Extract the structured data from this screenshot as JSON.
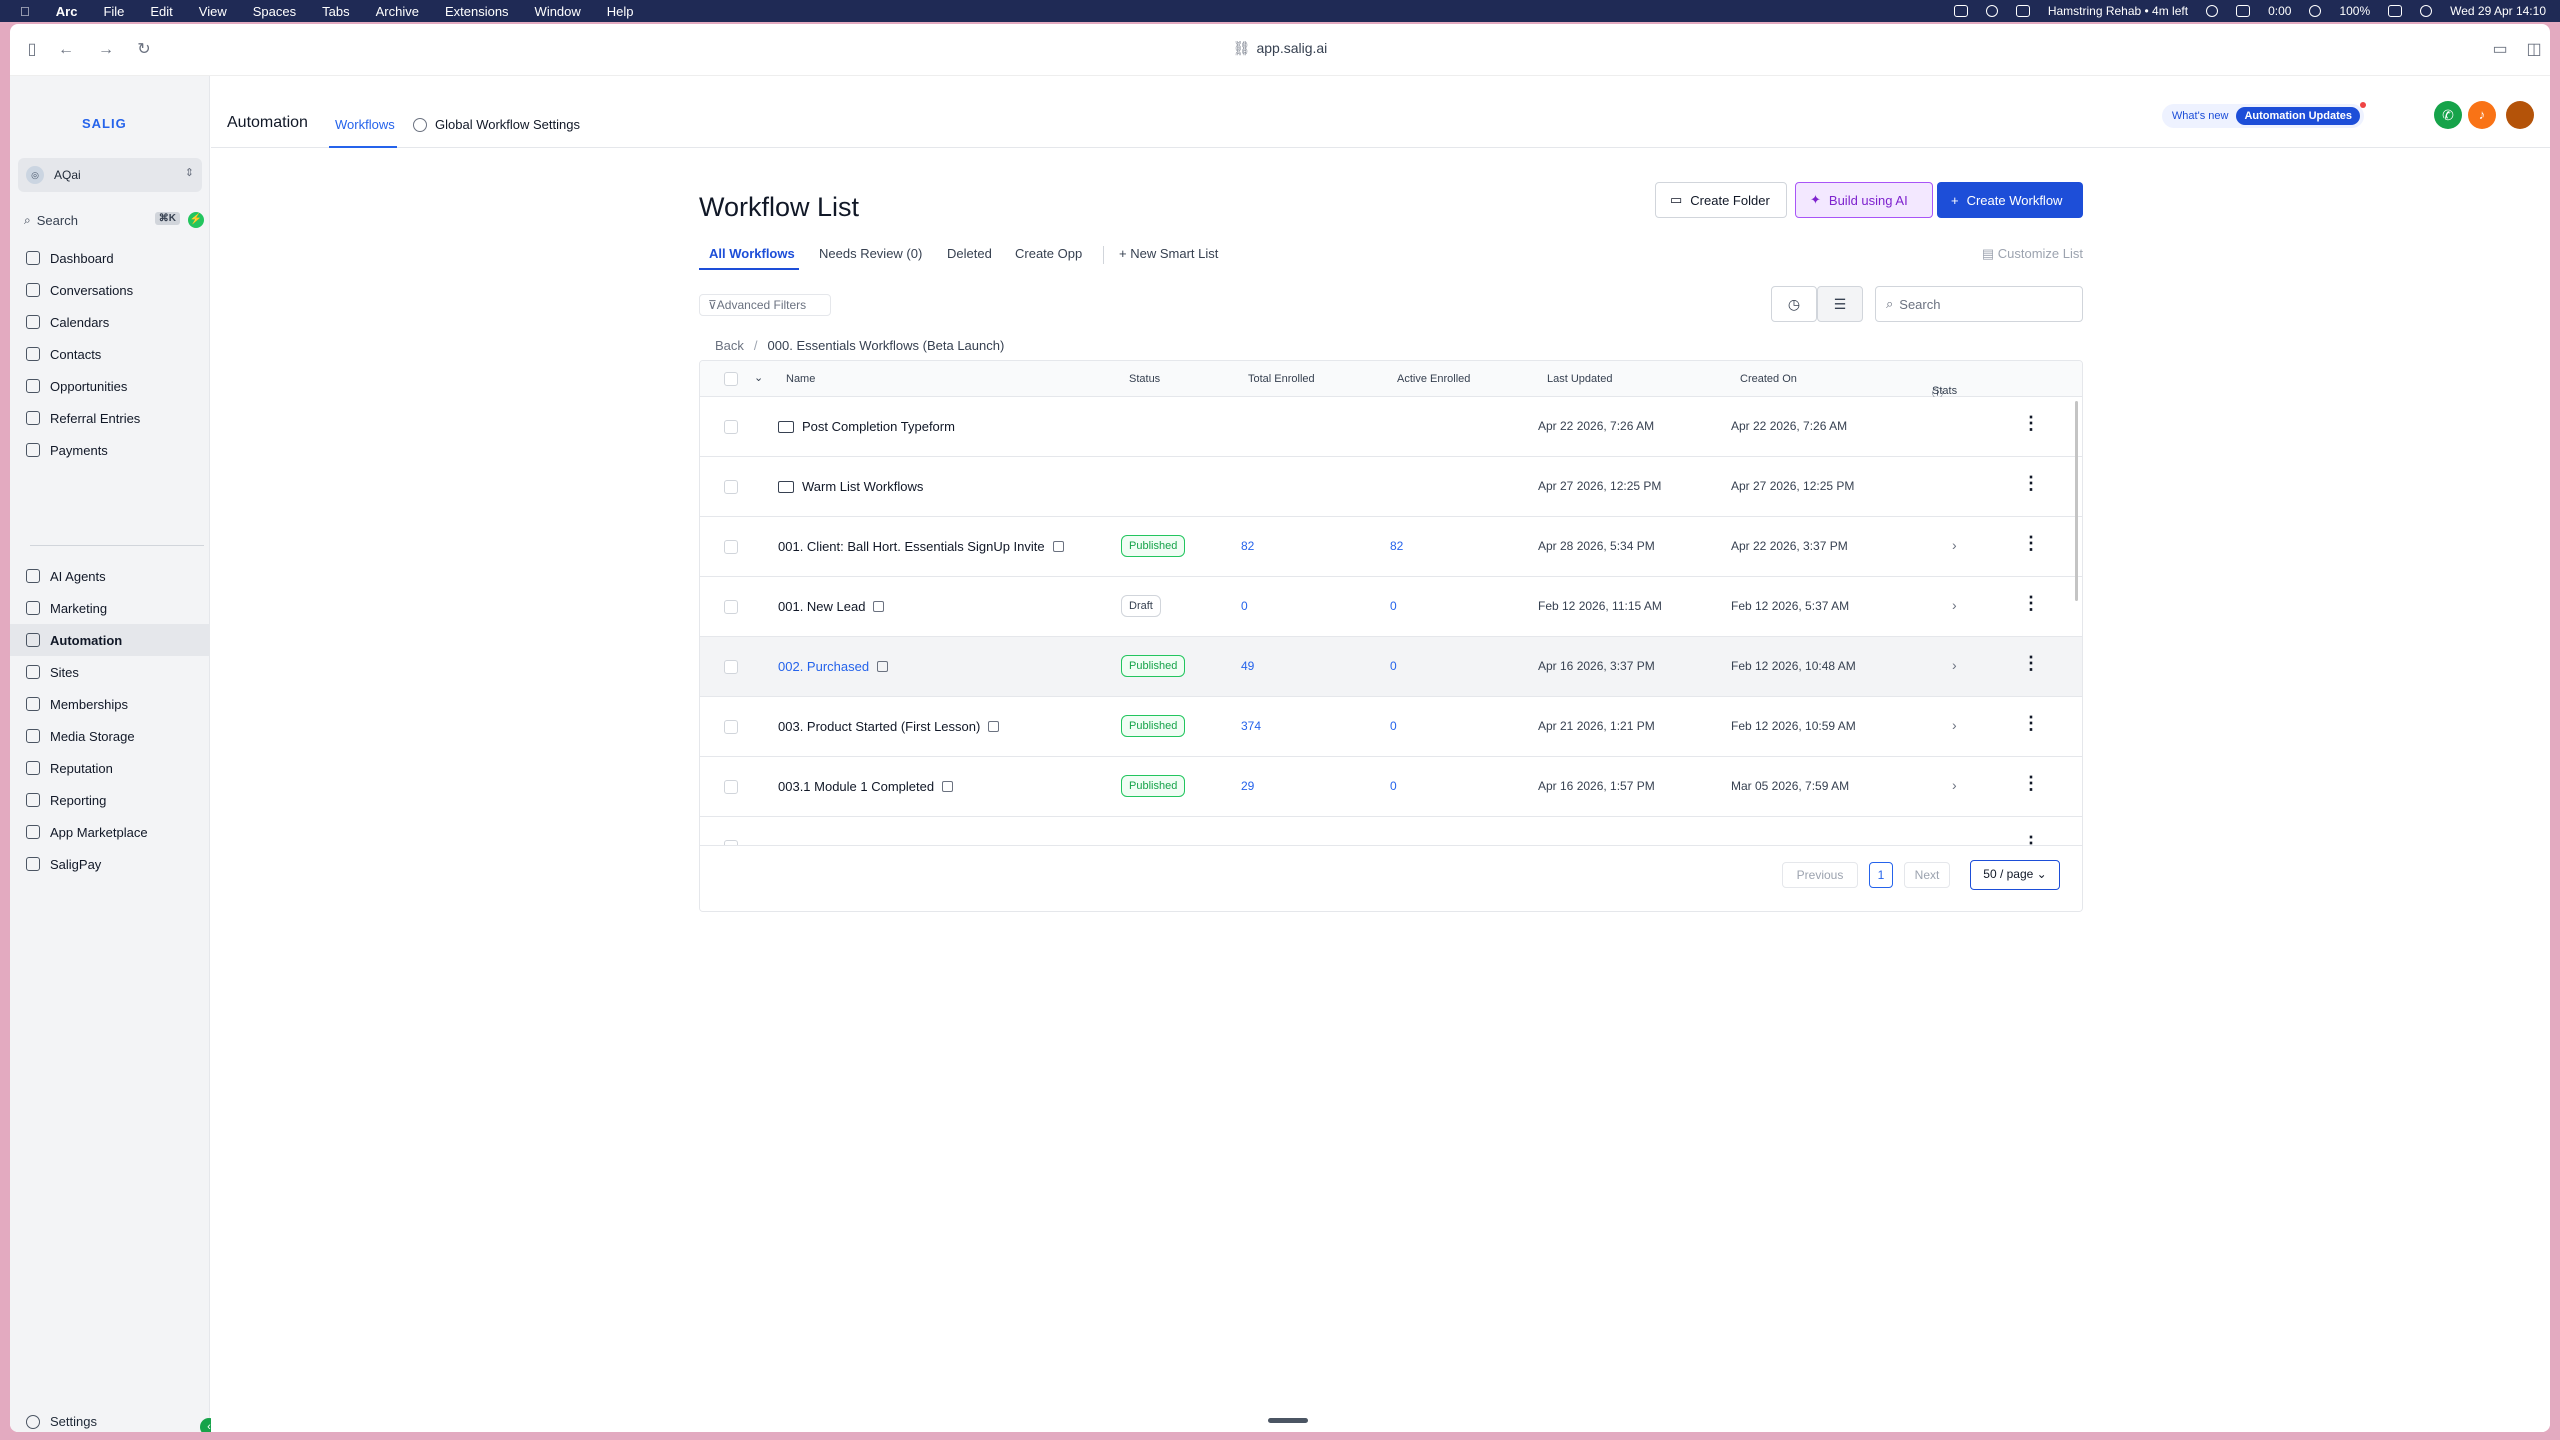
{
  "menubar": {
    "app": "Arc",
    "menus": [
      "File",
      "Edit",
      "View",
      "Spaces",
      "Tabs",
      "Archive",
      "Extensions",
      "Window",
      "Help"
    ],
    "status": {
      "timer": "Hamstring Rehab • 4m left",
      "counter": "0:00",
      "battery": "100%",
      "datetime": "Wed 29 Apr 14:10"
    }
  },
  "browser": {
    "url": "app.salig.ai"
  },
  "sidebar": {
    "logo": "SALIG",
    "account": "AQai",
    "search_label": "Search",
    "search_shortcut": "⌘K",
    "items_top": [
      "Dashboard",
      "Conversations",
      "Calendars",
      "Contacts",
      "Opportunities",
      "Referral Entries",
      "Payments"
    ],
    "items_bottom": [
      "AI Agents",
      "Marketing",
      "Automation",
      "Sites",
      "Memberships",
      "Media Storage",
      "Reputation",
      "Reporting",
      "App Marketplace",
      "SaligPay"
    ],
    "active": "Automation",
    "settings": "Settings"
  },
  "header": {
    "title": "Automation",
    "tab_workflows": "Workflows",
    "tab_global": "Global Workflow Settings",
    "whats_new": "What's new",
    "updates": "Automation Updates"
  },
  "page": {
    "title": "Workflow List",
    "btn_folder": "Create Folder",
    "btn_ai": "Build using AI",
    "btn_create": "Create Workflow",
    "tabs": [
      "All Workflows",
      "Needs Review (0)",
      "Deleted",
      "Create Opp"
    ],
    "new_smart_list": "New Smart List",
    "customize": "Customize List",
    "advanced_filters": "Advanced Filters",
    "search_placeholder": "Search",
    "breadcrumb_back": "Back",
    "breadcrumb_current": "000. Essentials Workflows (Beta Launch)"
  },
  "table": {
    "columns": [
      "Name",
      "Status",
      "Total Enrolled",
      "Active Enrolled",
      "Last Updated",
      "Created On",
      "Stats"
    ],
    "rows": [
      {
        "name": "Post Completion Typeform",
        "folder": true,
        "status": "",
        "total": "",
        "active": "",
        "updated": "Apr 22 2026, 7:26 AM",
        "created": "Apr 22 2026, 7:26 AM"
      },
      {
        "name": "Warm List Workflows",
        "folder": true,
        "status": "",
        "total": "",
        "active": "",
        "updated": "Apr 27 2026, 12:25 PM",
        "created": "Apr 27 2026, 12:25 PM"
      },
      {
        "name": "001. Client: Ball Hort. Essentials SignUp Invite",
        "folder": false,
        "status": "Published",
        "total": "82",
        "active": "82",
        "updated": "Apr 28 2026, 5:34 PM",
        "created": "Apr 22 2026, 3:37 PM"
      },
      {
        "name": "001. New Lead",
        "folder": false,
        "status": "Draft",
        "total": "0",
        "active": "0",
        "updated": "Feb 12 2026, 11:15 AM",
        "created": "Feb 12 2026, 5:37 AM"
      },
      {
        "name": "002. Purchased",
        "folder": false,
        "status": "Published",
        "total": "49",
        "active": "0",
        "updated": "Apr 16 2026, 3:37 PM",
        "created": "Feb 12 2026, 10:48 AM",
        "hover": true
      },
      {
        "name": "003. Product Started (First Lesson)",
        "folder": false,
        "status": "Published",
        "total": "374",
        "active": "0",
        "updated": "Apr 21 2026, 1:21 PM",
        "created": "Feb 12 2026, 10:59 AM"
      },
      {
        "name": "003.1 Module 1 Completed",
        "folder": false,
        "status": "Published",
        "total": "29",
        "active": "0",
        "updated": "Apr 16 2026, 1:57 PM",
        "created": "Mar 05 2026, 7:59 AM"
      }
    ]
  },
  "pager": {
    "prev": "Previous",
    "page": "1",
    "next": "Next",
    "size": "50 / page"
  }
}
